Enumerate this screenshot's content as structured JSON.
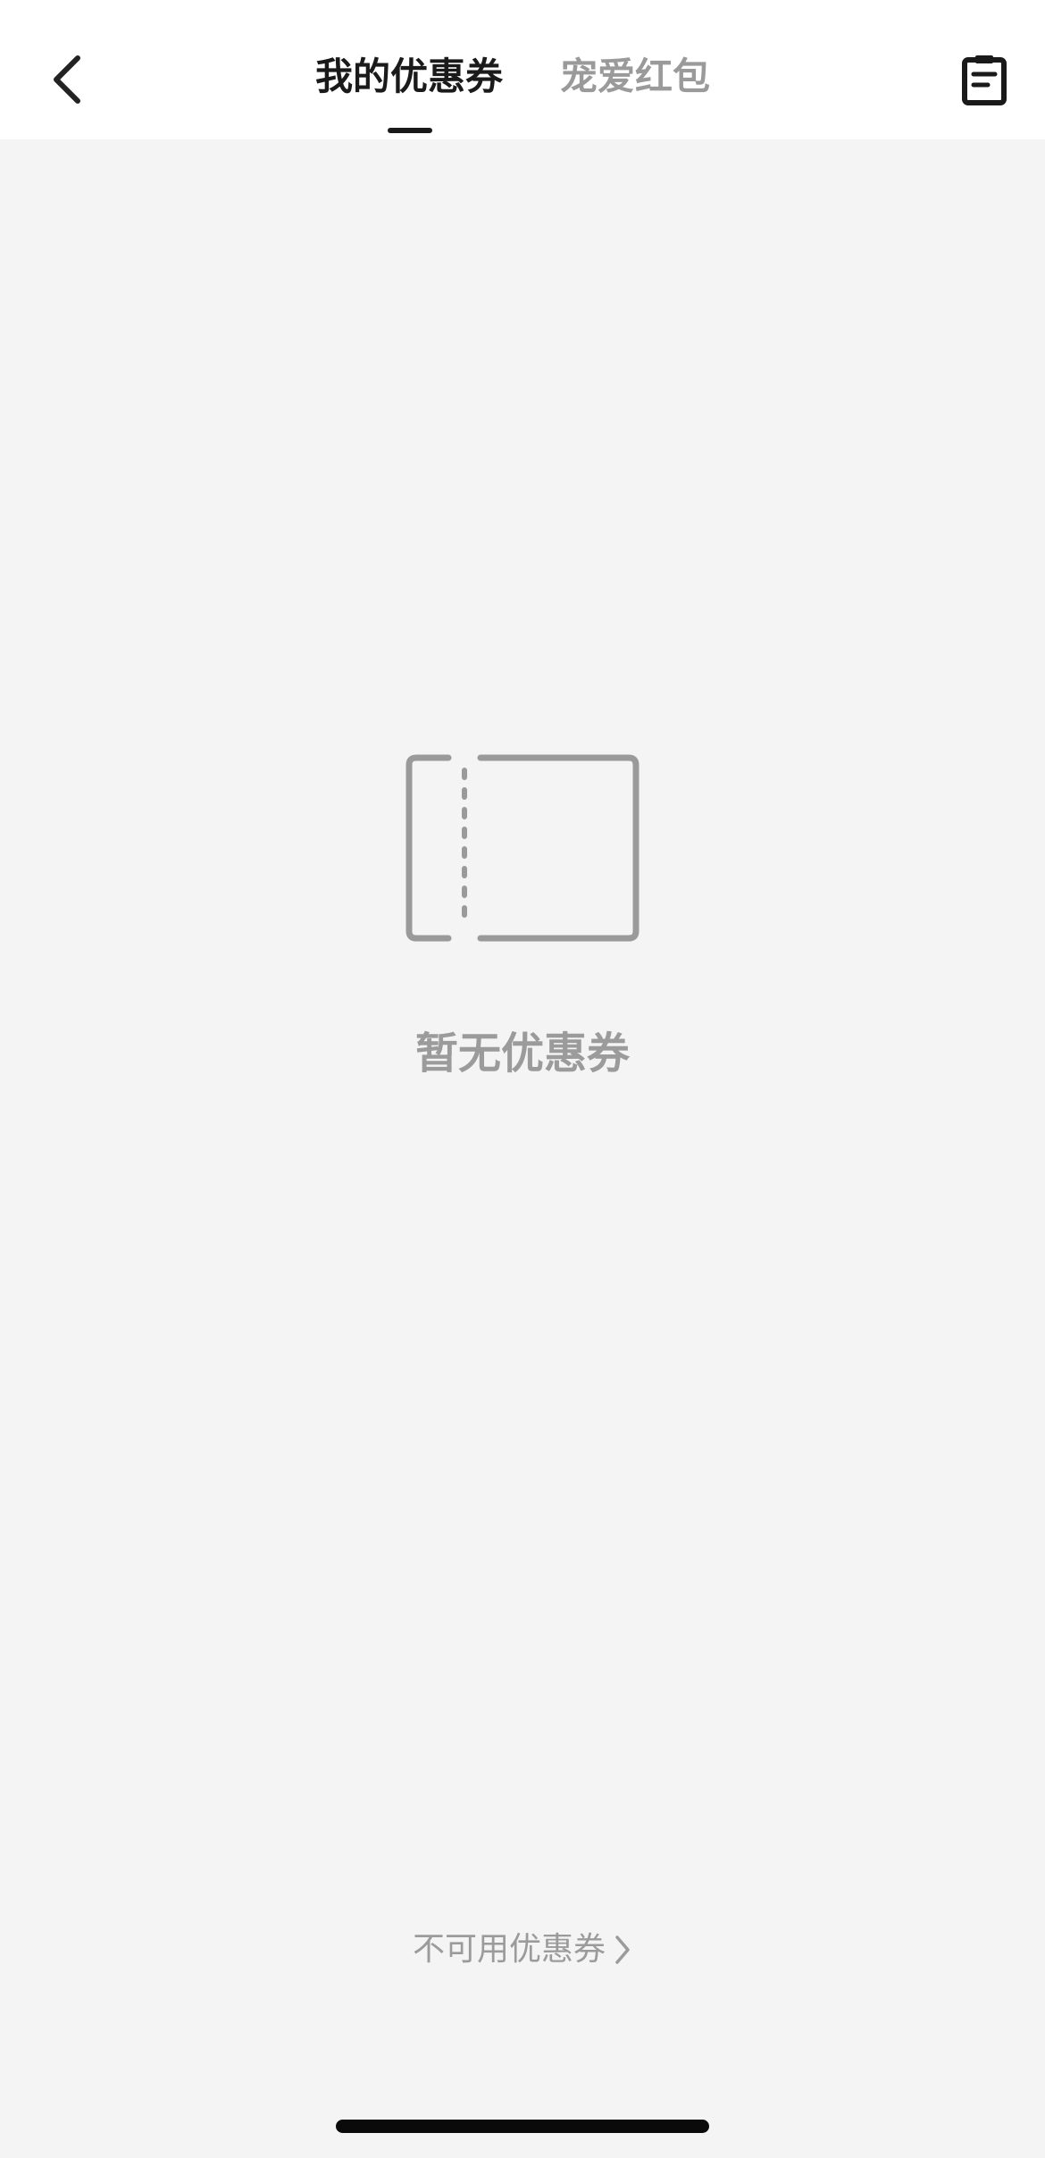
{
  "header": {
    "back_icon": "chevron-left-icon",
    "tabs": [
      {
        "label": "我的优惠券",
        "active": true
      },
      {
        "label": "宠爱红包",
        "active": false
      }
    ],
    "record_icon": "clipboard-icon"
  },
  "empty_state": {
    "icon": "coupon-ticket-icon",
    "message": "暂无优惠券"
  },
  "footer": {
    "unavailable_link_label": "不可用优惠券",
    "chevron_icon": "chevron-right-icon"
  },
  "colors": {
    "active_tab": "#1a1a1a",
    "inactive_tab": "#9a9a9a",
    "background": "#f4f4f4",
    "header_bg": "#ffffff",
    "muted_text": "#9b9b9b"
  }
}
